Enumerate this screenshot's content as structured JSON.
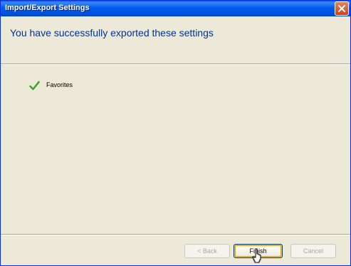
{
  "window": {
    "title": "Import/Export Settings",
    "close_icon": "close-icon"
  },
  "header": {
    "message": "You have successfully exported these settings"
  },
  "results": {
    "items": [
      {
        "label": "Favorites",
        "icon": "checkmark-icon",
        "status": "success"
      }
    ]
  },
  "buttons": {
    "back": "< Back",
    "finish": "Finish",
    "cancel": "Cancel"
  },
  "colors": {
    "titlebar": "#0054e3",
    "dialog_bg": "#ece9d8",
    "header_text": "#003399",
    "check": "#3fa52a",
    "close": "#c9441b"
  }
}
